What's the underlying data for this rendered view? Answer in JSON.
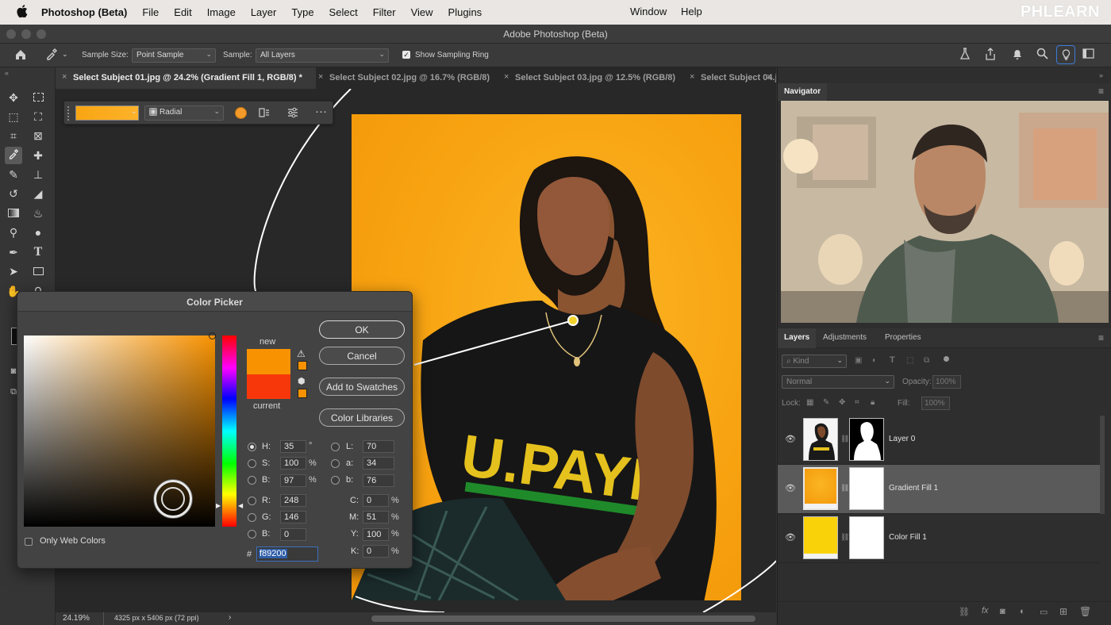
{
  "menubar": {
    "apple": "",
    "app_name": "Photoshop (Beta)",
    "items": [
      "File",
      "Edit",
      "Image",
      "Layer",
      "Type",
      "Select",
      "Filter",
      "View",
      "Plugins"
    ],
    "window": "Window",
    "help": "Help",
    "logo": "PHLEARN"
  },
  "window": {
    "title": "Adobe Photoshop (Beta)"
  },
  "options": {
    "sample_size_label": "Sample Size:",
    "sample_size_value": "Point Sample",
    "sample_label": "Sample:",
    "sample_value": "All Layers",
    "show_ring_label": "Show Sampling Ring",
    "show_ring_checked": true
  },
  "tabs": [
    {
      "label": "Select Subject 01.jpg @ 24.2% (Gradient Fill 1, RGB/8) *",
      "active": true
    },
    {
      "label": "Select Subject 02.jpg @ 16.7% (RGB/8)",
      "active": false
    },
    {
      "label": "Select Subject 03.jpg @ 12.5% (RGB/8)",
      "active": false
    },
    {
      "label": "Select Subject 04.j",
      "active": false
    }
  ],
  "gradient_bar": {
    "type": "Radial",
    "color": "#f89200"
  },
  "status": {
    "zoom": "24.19%",
    "doc_info": "4325 px x 5406 px (72 ppi)",
    "arrow": "›"
  },
  "color_picker": {
    "title": "Color Picker",
    "new_label": "new",
    "current_label": "current",
    "new_color": "#f89200",
    "current_color": "#f7370a",
    "buttons": {
      "ok": "OK",
      "cancel": "Cancel",
      "add_swatches": "Add to Swatches",
      "libraries": "Color Libraries"
    },
    "only_web_label": "Only Web Colors",
    "only_web_checked": false,
    "hsb": {
      "h_label": "H:",
      "h": "35",
      "h_unit": "°",
      "s_label": "S:",
      "s": "100",
      "s_unit": "%",
      "b_label": "B:",
      "b": "97",
      "b_unit": "%"
    },
    "rgb": {
      "r_label": "R:",
      "r": "248",
      "g_label": "G:",
      "g": "146",
      "b_label": "B:",
      "b": "0"
    },
    "lab": {
      "l_label": "L:",
      "l": "70",
      "a_label": "a:",
      "a": "34",
      "b_label": "b:",
      "b": "76"
    },
    "cmyk": {
      "c_label": "C:",
      "c": "0",
      "m_label": "M:",
      "m": "51",
      "y_label": "Y:",
      "y": "100",
      "k_label": "K:",
      "k": "0",
      "unit": "%"
    },
    "hex_label": "#",
    "hex": "f89200",
    "selected_mode": "H"
  },
  "navigator": {
    "title": "Navigator"
  },
  "layers_panel": {
    "tabs": [
      "Layers",
      "Adjustments",
      "Properties"
    ],
    "kind_placeholder": "Kind",
    "blend_mode": "Normal",
    "opacity_label": "Opacity:",
    "opacity_value": "100%",
    "lock_label": "Lock:",
    "fill_label": "Fill:",
    "fill_value": "100%",
    "layers": [
      {
        "name": "Layer 0",
        "selected": false
      },
      {
        "name": "Gradient Fill 1",
        "selected": true
      },
      {
        "name": "Color Fill 1",
        "selected": false
      }
    ]
  },
  "colors": {
    "accent": "#f89200",
    "fill_yellow": "#f9d20a",
    "bg": "#282828",
    "panel": "#2e2e2e"
  }
}
